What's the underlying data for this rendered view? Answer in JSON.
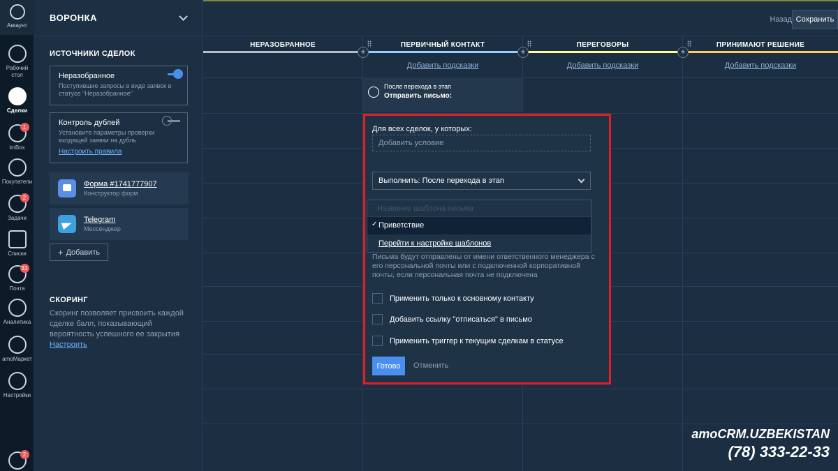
{
  "rail": {
    "account": "Аккаунт",
    "items": [
      {
        "label": "Рабочий стол",
        "icon": "speedometer-icon",
        "badge": ""
      },
      {
        "label": "Сделки",
        "icon": "deals-icon",
        "badge": ""
      },
      {
        "label": "imBox",
        "icon": "chat-icon",
        "badge": "1"
      },
      {
        "label": "Покупатели",
        "icon": "customers-icon",
        "badge": ""
      },
      {
        "label": "Задачи",
        "icon": "tasks-icon",
        "badge": "2"
      },
      {
        "label": "Списки",
        "icon": "lists-icon",
        "badge": ""
      },
      {
        "label": "Почта",
        "icon": "mail-icon",
        "badge": "31"
      },
      {
        "label": "Аналитика",
        "icon": "analytics-icon",
        "badge": ""
      },
      {
        "label": "amoМаркет",
        "icon": "market-icon",
        "badge": ""
      },
      {
        "label": "Настройки",
        "icon": "settings-icon",
        "badge": ""
      }
    ],
    "bottom_badge": "2"
  },
  "panel": {
    "title": "ВОРОНКА",
    "sources_title": "ИСТОЧНИКИ СДЕЛОК",
    "unsorted": {
      "title": "Неразобранное",
      "desc": "Поступившие запросы в виде заявок в статусе \"Неразобранное\""
    },
    "duplicates": {
      "title": "Контроль дублей",
      "desc": "Установите параметры проверки входящей заявки на дубль",
      "link": "Настроить правила"
    },
    "integrations": [
      {
        "title": "Форма #1741777907",
        "desc": "Конструктор форм"
      },
      {
        "title": "Telegram",
        "desc": "Мессенджер"
      }
    ],
    "add": "Добавить",
    "scoring_title": "СКОРИНГ",
    "scoring_text": "Скоринг позволяет присвоить каждой сделке балл, показывающий вероятность успешного ее закрытия",
    "scoring_link": "Настроить"
  },
  "topbar": {
    "back": "Назад",
    "save": "Сохранить"
  },
  "columns": [
    {
      "title": "НЕРАЗОБРАННОЕ",
      "color": "#b7bec7",
      "link": ""
    },
    {
      "title": "ПЕРВИЧНЫЙ КОНТАКТ",
      "color": "#99ccff",
      "link": "Добавить подсказки"
    },
    {
      "title": "ПЕРЕГОВОРЫ",
      "color": "#ffff99",
      "link": "Добавить подсказки"
    },
    {
      "title": "ПРИНИМАЮТ РЕШЕНИЕ",
      "color": "#ffcc66",
      "link": "Добавить подсказки"
    }
  ],
  "trigger": {
    "line1": "После перехода в этап",
    "line2": "Отправить письмо:"
  },
  "modal": {
    "label": "Для всех сделок, у которых:",
    "condition_placeholder": "Добавить условие",
    "execute": "Выполнить: После перехода в этап",
    "search_placeholder": "Название шаблона письма",
    "option": "Приветствие",
    "option_check": "✓",
    "templates_link": "Перейти к настройке шаблонов",
    "note": "Письма будут отправлены от имени ответственного менеджера с его персональной почты или с подключенной корпоративной почты, если персональная почта не подключена",
    "checkboxes": [
      "Применить только к основному контакту",
      "Добавить ссылку \"отписаться\" в письмо",
      "Применить триггер к текущим сделкам в статусе"
    ],
    "done": "Готово",
    "cancel": "Отменить"
  },
  "watermark": {
    "brand": "amoCRM.UZBEKISTAN",
    "phone": "(78) 333-22-33"
  }
}
